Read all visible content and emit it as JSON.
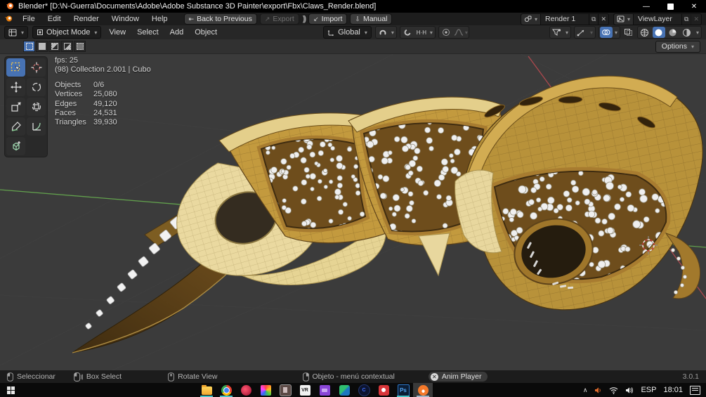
{
  "window": {
    "title": "Blender* [D:\\N-Guerra\\Documents\\Adobe\\Adobe Substance 3D Painter\\export\\Fbx\\Claws_Render.blend]"
  },
  "topbar": {
    "menus": [
      "File",
      "Edit",
      "Render",
      "Window",
      "Help"
    ],
    "back_button": "Back to Previous",
    "export_button": "Export",
    "import_button": "Import",
    "manual_button": "Manual",
    "scene_name": "Render 1",
    "view_layer_name": "ViewLayer"
  },
  "viewport_header": {
    "mode": "Object Mode",
    "menus": [
      "View",
      "Select",
      "Add",
      "Object"
    ],
    "orientation": "Global"
  },
  "tool_settings": {
    "options_label": "Options"
  },
  "stats": {
    "fps": "fps: 25",
    "active": "(98) Collection 2.001 | Cubo",
    "rows": [
      [
        "Objects",
        "0/6"
      ],
      [
        "Vertices",
        "25,080"
      ],
      [
        "Edges",
        "49,120"
      ],
      [
        "Faces",
        "24,531"
      ],
      [
        "Triangles",
        "39,930"
      ]
    ]
  },
  "status_bar": {
    "hints": [
      "Seleccionar",
      "Box Select",
      "Rotate View",
      "Objeto - menú contextual"
    ],
    "anim_player": "Anim Player",
    "version": "3.0.1"
  },
  "taskbar": {
    "icons": [
      {
        "name": "file-explorer",
        "running": true
      },
      {
        "name": "chrome",
        "running": true
      },
      {
        "name": "substance-painter",
        "running": false
      },
      {
        "name": "photos",
        "running": false
      },
      {
        "name": "gallery",
        "running": false
      },
      {
        "name": "vr-app",
        "running": false,
        "glyph": "VR"
      },
      {
        "name": "remote-display",
        "running": false
      },
      {
        "name": "bluestacks",
        "running": false
      },
      {
        "name": "capture-c",
        "running": false,
        "glyph": "C"
      },
      {
        "name": "screen-recorder",
        "running": false
      },
      {
        "name": "photoshop",
        "running": true,
        "glyph": "Ps"
      },
      {
        "name": "blender",
        "running": true,
        "active": true
      }
    ],
    "language": "ESP",
    "time": "18:01"
  },
  "colors": {
    "accent_blue": "#4772b3",
    "axis_green": "#62a04d",
    "axis_red": "#b84a50",
    "gold": "#c39a3e",
    "pale_gold": "#e9d99f",
    "dark_brown": "#5e431a",
    "gem_white": "#efefef"
  }
}
